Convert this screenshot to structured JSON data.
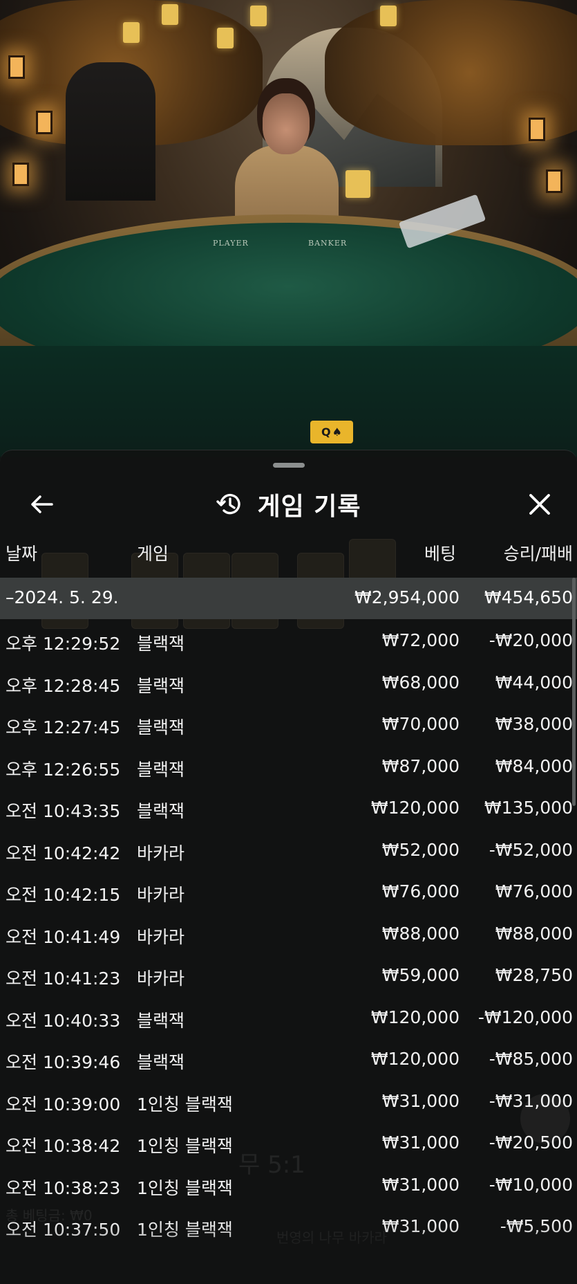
{
  "video": {
    "felt_labels": [
      "PLAYER",
      "BANKER"
    ],
    "card_chip": [
      "Q",
      "♠"
    ]
  },
  "sheet": {
    "title": "게임 기록",
    "icons": {
      "back": "back-arrow-icon",
      "history": "history-clock-icon",
      "close": "close-icon"
    },
    "columns": {
      "date": "날짜",
      "game": "게임",
      "bet": "베팅",
      "result": "승리/패배"
    },
    "date_group": {
      "date": "–2024. 5. 29.",
      "bet_total": "₩2,954,000",
      "result_total": "₩454,650"
    },
    "rows": [
      {
        "time": "오후 12:29:52",
        "game": "블랙잭",
        "bet": "₩72,000",
        "result": "-₩20,000"
      },
      {
        "time": "오후 12:28:45",
        "game": "블랙잭",
        "bet": "₩68,000",
        "result": "₩44,000"
      },
      {
        "time": "오후 12:27:45",
        "game": "블랙잭",
        "bet": "₩70,000",
        "result": "₩38,000"
      },
      {
        "time": "오후 12:26:55",
        "game": "블랙잭",
        "bet": "₩87,000",
        "result": "₩84,000"
      },
      {
        "time": "오전 10:43:35",
        "game": "블랙잭",
        "bet": "₩120,000",
        "result": "₩135,000"
      },
      {
        "time": "오전 10:42:42",
        "game": "바카라",
        "bet": "₩52,000",
        "result": "-₩52,000"
      },
      {
        "time": "오전 10:42:15",
        "game": "바카라",
        "bet": "₩76,000",
        "result": "₩76,000"
      },
      {
        "time": "오전 10:41:49",
        "game": "바카라",
        "bet": "₩88,000",
        "result": "₩88,000"
      },
      {
        "time": "오전 10:41:23",
        "game": "바카라",
        "bet": "₩59,000",
        "result": "₩28,750"
      },
      {
        "time": "오전 10:40:33",
        "game": "블랙잭",
        "bet": "₩120,000",
        "result": "-₩120,000"
      },
      {
        "time": "오전 10:39:46",
        "game": "블랙잭",
        "bet": "₩120,000",
        "result": "-₩85,000"
      },
      {
        "time": "오전 10:39:00",
        "game": "1인칭 블랙잭",
        "bet": "₩31,000",
        "result": "-₩31,000"
      },
      {
        "time": "오전 10:38:42",
        "game": "1인칭 블랙잭",
        "bet": "₩31,000",
        "result": "-₩20,500"
      },
      {
        "time": "오전 10:38:23",
        "game": "1인칭 블랙잭",
        "bet": "₩31,000",
        "result": "-₩10,000"
      },
      {
        "time": "오전 10:37:50",
        "game": "1인칭 블랙잭",
        "bet": "₩31,000",
        "result": "-₩5,500"
      }
    ]
  },
  "background_ghost": {
    "payout_text": "무 5:1",
    "total_bet_text": "총 베팅금: ₩0",
    "table_name_text": "번영의 나무 바카라"
  }
}
